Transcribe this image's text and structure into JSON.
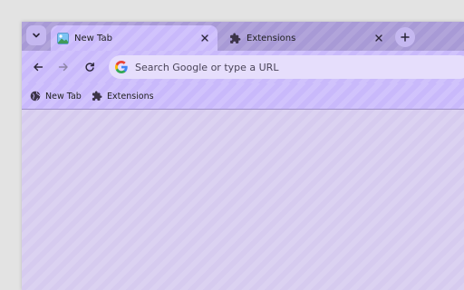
{
  "tabstrip": {
    "tabs": [
      {
        "title": "New Tab",
        "icon": "new-tab-favicon",
        "active": true
      },
      {
        "title": "Extensions",
        "icon": "puzzle-icon",
        "active": false
      }
    ],
    "search_icon": "chevron-down-icon",
    "new_tab_icon": "plus-icon"
  },
  "toolbar": {
    "back_icon": "arrow-left-icon",
    "forward_icon": "arrow-right-icon",
    "reload_icon": "reload-icon",
    "omnibox": {
      "placeholder": "Search Google or type a URL",
      "value": "",
      "icon": "google-icon"
    }
  },
  "bookmarks": [
    {
      "label": "New Tab",
      "icon": "globe-icon"
    },
    {
      "label": "Extensions",
      "icon": "puzzle-icon"
    }
  ],
  "theme": {
    "accent": "#c9b9fb",
    "frame": "#a89ad6",
    "content": "#d6cbef"
  }
}
